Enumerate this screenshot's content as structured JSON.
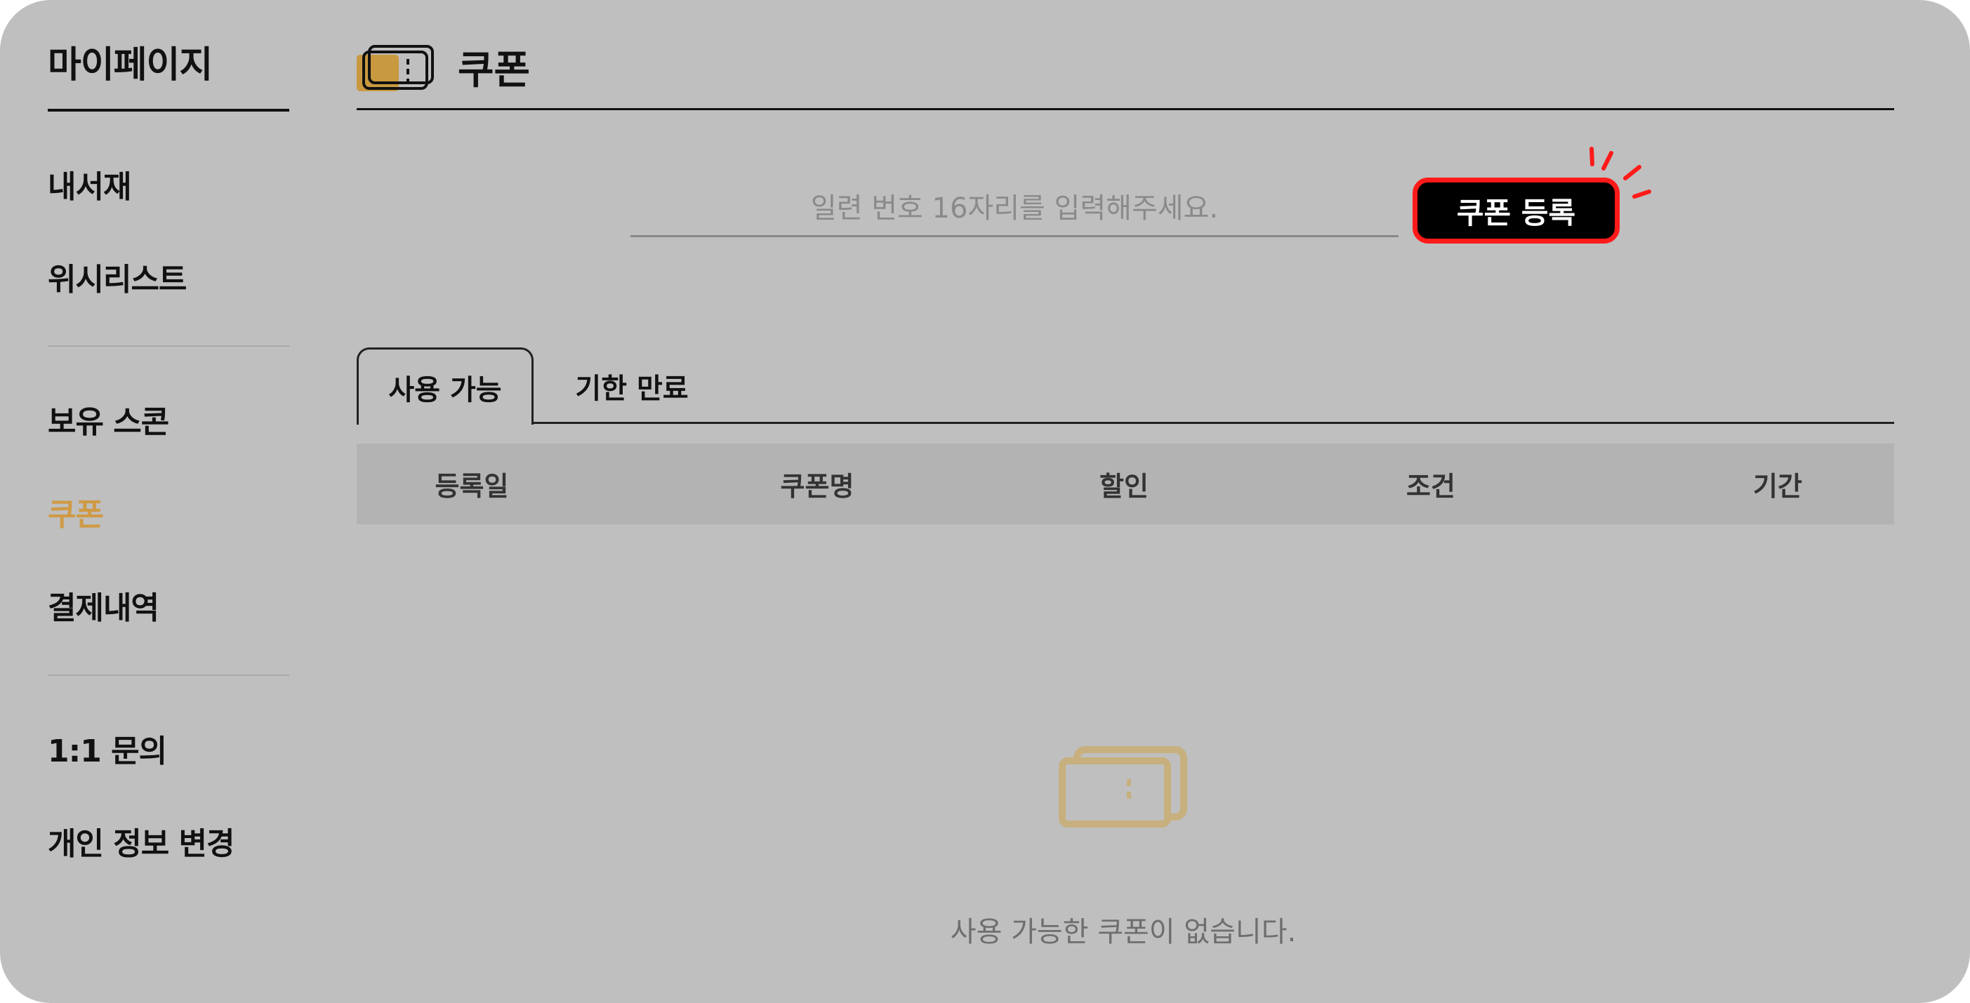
{
  "sidebar": {
    "title": "마이페이지",
    "items": [
      {
        "label": "내서재"
      },
      {
        "label": "위시리스트"
      },
      {
        "label": "보유 스콘"
      },
      {
        "label": "쿠폰"
      },
      {
        "label": "결제내역"
      },
      {
        "label": "1:1 문의"
      },
      {
        "label": "개인 정보 변경"
      }
    ],
    "active_item": "쿠폰"
  },
  "header": {
    "title": "쿠폰",
    "icon": "coupon-ticket-icon"
  },
  "coupon_register": {
    "input_value": "",
    "placeholder": "일련 번호 16자리를 입력해주세요.",
    "button_label": "쿠폰 등록"
  },
  "tabs": [
    {
      "label": "사용 가능",
      "active": true
    },
    {
      "label": "기한 만료",
      "active": false
    }
  ],
  "table": {
    "columns": [
      "등록일",
      "쿠폰명",
      "할인",
      "조건",
      "기간"
    ],
    "rows": []
  },
  "empty_state": {
    "icon": "coupon-ticket-icon",
    "message": "사용 가능한 쿠폰이 없습니다."
  },
  "colors": {
    "background": "#bfbfbf",
    "accent": "#cf9a45",
    "highlight": "#ff1a1a",
    "button": "#000000"
  }
}
